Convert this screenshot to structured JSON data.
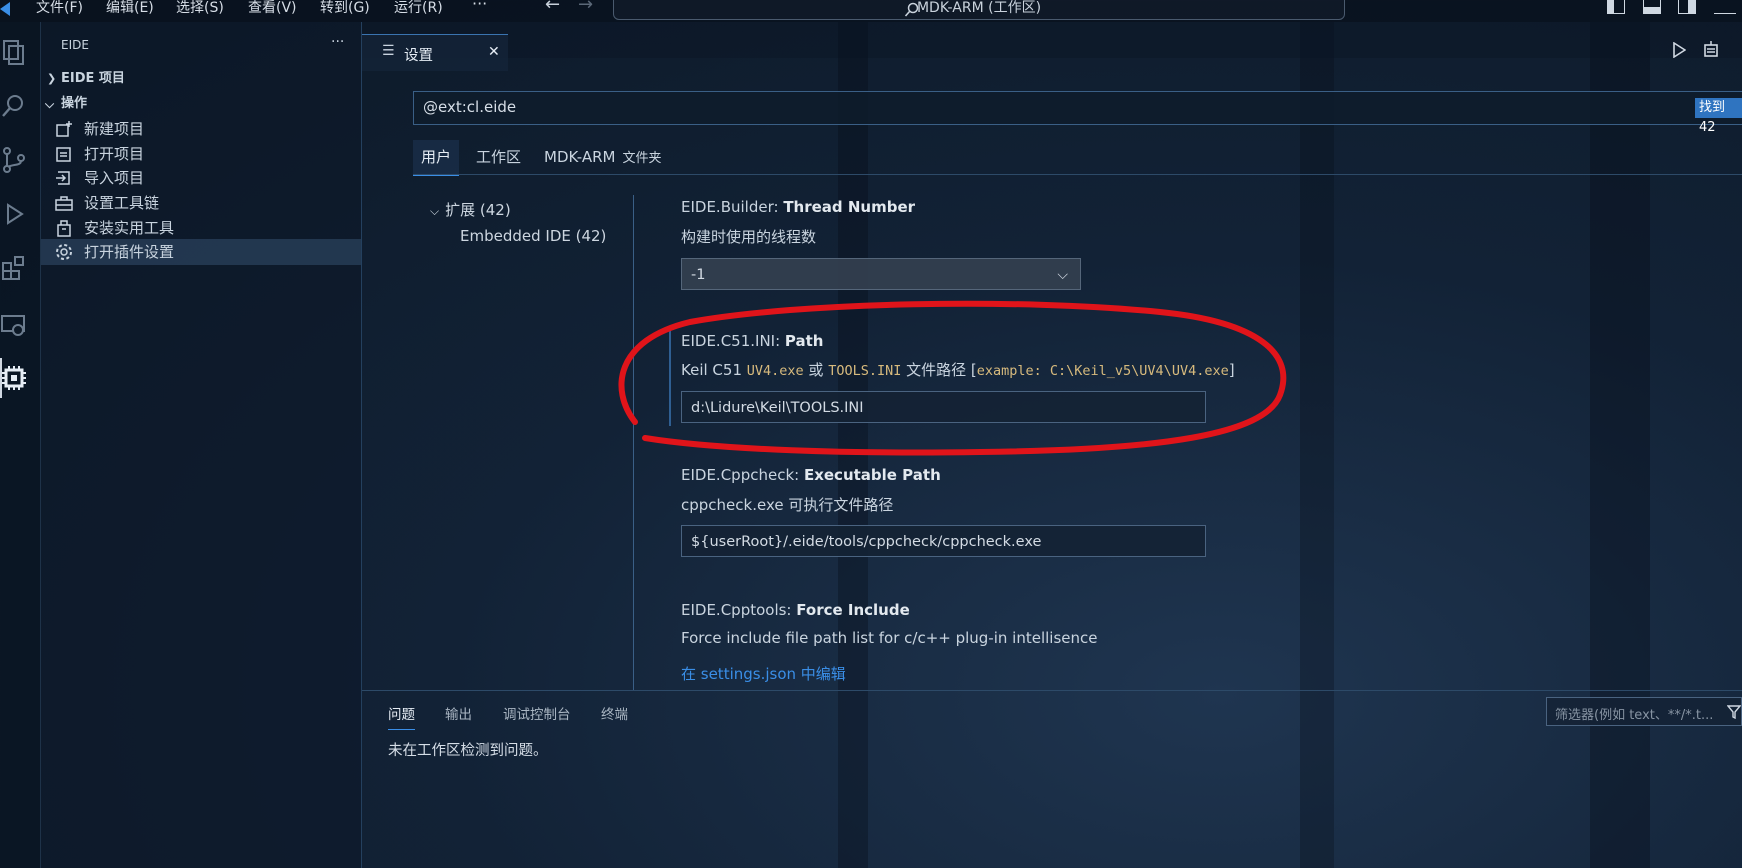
{
  "menu": {
    "items": [
      "文件(F)",
      "编辑(E)",
      "选择(S)",
      "查看(V)",
      "转到(G)",
      "运行(R)"
    ],
    "more": "···"
  },
  "command_center": "MDK-ARM (工作区)",
  "sidebar": {
    "title": "EIDE",
    "more": "···",
    "sections": [
      {
        "label": "EIDE 项目"
      },
      {
        "label": "操作"
      }
    ],
    "items": [
      {
        "label": "新建项目",
        "icon": "new-project-icon"
      },
      {
        "label": "打开项目",
        "icon": "open-project-icon"
      },
      {
        "label": "导入项目",
        "icon": "import-project-icon"
      },
      {
        "label": "设置工具链",
        "icon": "toolchain-icon"
      },
      {
        "label": "安装实用工具",
        "icon": "install-tools-icon"
      },
      {
        "label": "打开插件设置",
        "icon": "gear-icon"
      }
    ]
  },
  "tab": {
    "label": "设置",
    "close": "✕"
  },
  "settings": {
    "search_value": "@ext:cl.eide",
    "found_badge": "找到 42",
    "scopes": [
      "用户",
      "工作区",
      "MDK-ARM"
    ],
    "scope_suffix": "文件夹",
    "toc": {
      "group": "扩展 (42)",
      "item": "Embedded IDE (42)"
    },
    "items": [
      {
        "prefix": "EIDE.Builder: ",
        "name": "Thread Number",
        "desc": "构建时使用的线程数",
        "value": "-1"
      },
      {
        "prefix": "EIDE.C51.INI: ",
        "name": "Path",
        "desc_parts": [
          "Keil C51 ",
          "UV4.exe",
          " 或 ",
          "TOOLS.INI",
          " 文件路径 [",
          "example: C:\\Keil_v5\\UV4\\UV4.exe",
          "]"
        ],
        "value": "d:\\Lidure\\Keil\\TOOLS.INI"
      },
      {
        "prefix": "EIDE.Cppcheck: ",
        "name": "Executable Path",
        "desc": "cppcheck.exe 可执行文件路径",
        "value": "${userRoot}/.eide/tools/cppcheck/cppcheck.exe"
      },
      {
        "prefix": "EIDE.Cpptools: ",
        "name": "Force Include",
        "desc": "Force include file path list for c/c++ plug-in intellisence",
        "link": "在 settings.json 中编辑"
      }
    ]
  },
  "panel": {
    "tabs": [
      "问题",
      "输出",
      "调试控制台",
      "终端"
    ],
    "filter_placeholder": "筛选器(例如 text、**/*.t...",
    "message": "未在工作区检测到问题。"
  },
  "colors": {
    "accent": "#3a8ee6",
    "annotation": "#e0141a",
    "code": "#d7ba7d"
  }
}
